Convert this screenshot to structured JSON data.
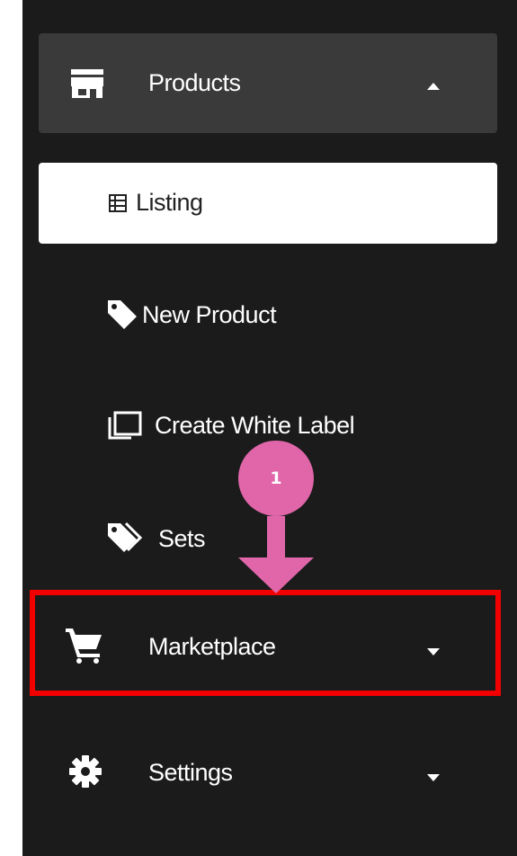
{
  "sidebar": {
    "products": {
      "label": "Products",
      "icon": "store-icon",
      "expanded": true
    },
    "sub_items": [
      {
        "label": "Listing",
        "icon": "table-list-icon",
        "active": true
      },
      {
        "label": "New Product",
        "icon": "tag-icon"
      },
      {
        "label": "Create White Label",
        "icon": "copy-icon"
      },
      {
        "label": "Sets",
        "icon": "tags-icon"
      }
    ],
    "marketplace": {
      "label": "Marketplace",
      "icon": "shopping-cart-icon"
    },
    "settings": {
      "label": "Settings",
      "icon": "gear-icon"
    }
  },
  "annotation": {
    "step_number": "1",
    "circle_color": "#e066a9",
    "highlight_color": "#f20000"
  },
  "colors": {
    "sidebar_bg": "#1b1b1b",
    "expanded_header_bg": "#3a3a3a",
    "active_item_bg": "#ffffff"
  }
}
